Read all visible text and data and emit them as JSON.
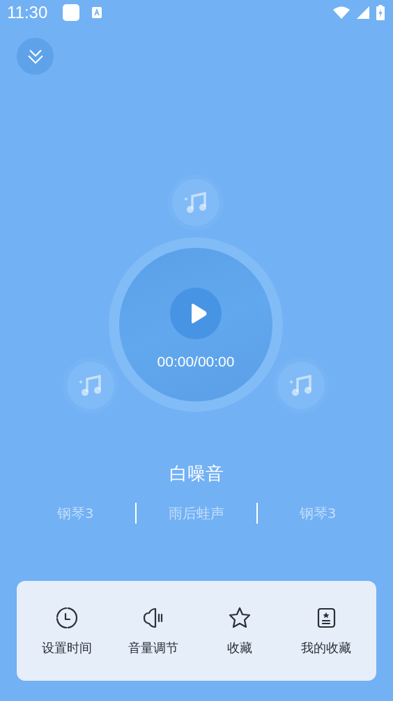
{
  "status_bar": {
    "time": "11:30"
  },
  "player": {
    "time": "00:00/00:00",
    "title": "白噪音"
  },
  "tracks": [
    {
      "label": "钢琴3"
    },
    {
      "label": "雨后蛙声"
    },
    {
      "label": "钢琴3"
    }
  ],
  "actions": [
    {
      "kind": "clock",
      "label": "设置时间"
    },
    {
      "kind": "volume",
      "label": "音量调节"
    },
    {
      "kind": "star",
      "label": "收藏"
    },
    {
      "kind": "book",
      "label": "我的收藏"
    }
  ]
}
